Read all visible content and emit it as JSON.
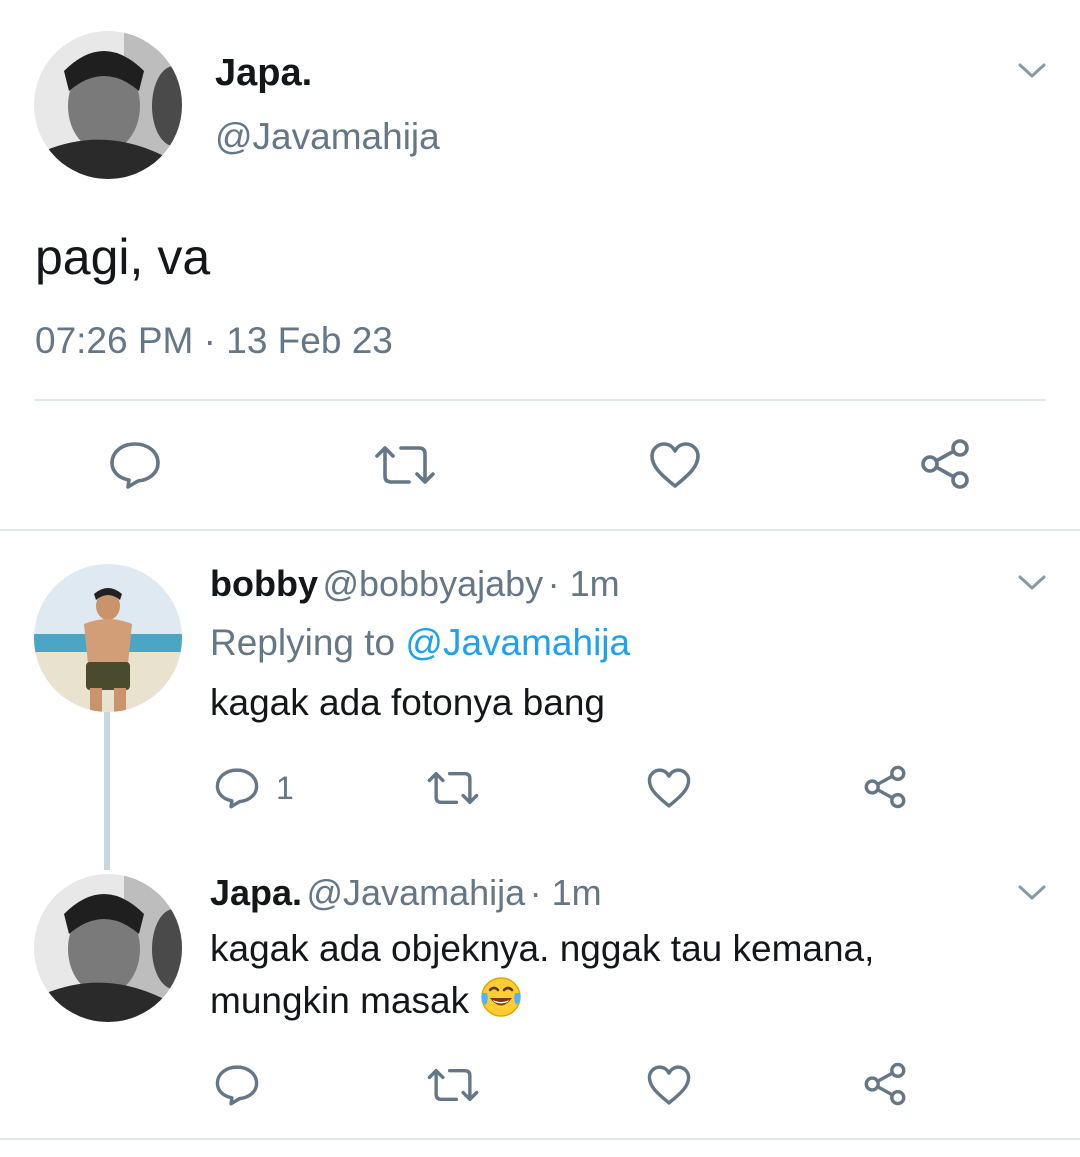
{
  "main_tweet": {
    "author_name": "Japa.",
    "author_handle": "@Javamahija",
    "text": "pagi, va",
    "timestamp": "07:26 PM · 13 Feb 23"
  },
  "replies": [
    {
      "author_name": "bobby",
      "author_handle": "@bobbyajaby",
      "time": "· 1m",
      "replying_prefix": "Replying to",
      "replying_handle": "@Javamahija",
      "text": "kagak ada fotonya bang",
      "reply_count": "1"
    },
    {
      "author_name": "Japa.",
      "author_handle": "@Javamahija",
      "time": "· 1m",
      "text_line1": "kagak ada objeknya. nggak tau kemana,",
      "text_line2": "mungkin masak",
      "emoji": "face-with-tears-of-joy",
      "reply_count": ""
    }
  ],
  "icons": {
    "reply": "reply-icon",
    "retweet": "retweet-icon",
    "like": "heart-icon",
    "share": "share-icon",
    "more": "chevron-down-icon"
  },
  "colors": {
    "text": "#14171a",
    "secondary": "#657786",
    "link": "#1da1f2",
    "divider": "#e1e8ed",
    "thread_line": "#ccd6dd"
  }
}
